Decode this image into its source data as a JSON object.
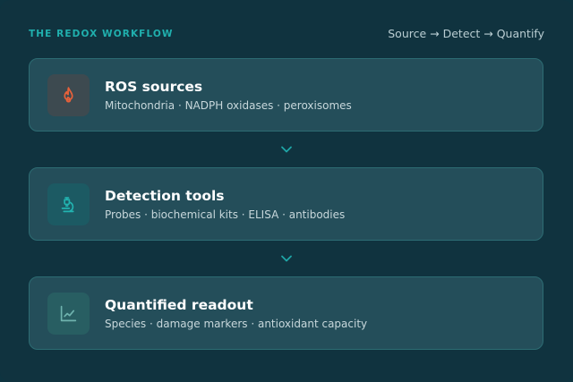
{
  "header": {
    "eyebrow": "THE REDOX WORKFLOW",
    "flow": "Source → Detect → Quantify"
  },
  "cards": [
    {
      "title": "ROS sources",
      "subtitle": "Mitochondria · NADPH oxidases · peroxisomes",
      "icon": "flame-icon",
      "accent": "#e8613a"
    },
    {
      "title": "Detection tools",
      "subtitle": "Probes · biochemical kits · ELISA · antibodies",
      "icon": "microscope-icon",
      "accent": "#22b3b0"
    },
    {
      "title": "Quantified readout",
      "subtitle": "Species · damage markers · antioxidant capacity",
      "icon": "line-chart-icon",
      "accent": "#6fb3ae"
    }
  ],
  "colors": {
    "background": "#10333f",
    "card": "#244e5a",
    "card_border": "#2d6c73",
    "eyebrow": "#20b0ae",
    "chevron": "#1fa5a6"
  }
}
